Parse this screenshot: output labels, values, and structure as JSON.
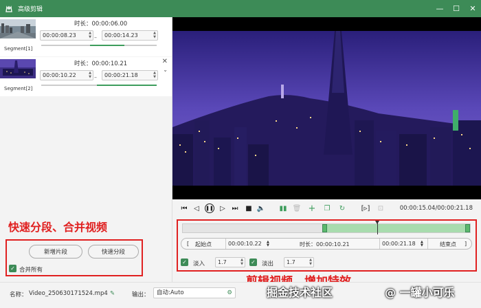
{
  "window": {
    "title": "高级剪辑",
    "min": "—",
    "max": "☐",
    "close": "✕"
  },
  "segments": [
    {
      "label": "Segment[1]",
      "duration": "时长：00:00:06.00",
      "start": "00:00:08.23",
      "end": "00:00:14.23",
      "fill_start": 0.42,
      "fill_end": 0.72
    },
    {
      "label": "Segment[2]",
      "duration": "时长：00:00:10.21",
      "start": "00:00:10.22",
      "end": "00:00:21.18",
      "fill_start": 0.48,
      "fill_end": 1.0
    }
  ],
  "left_panel": {
    "annotation": "快速分段、合并视频",
    "add_segment": "新增片段",
    "quick_split": "快速分段",
    "merge_all": "合并所有"
  },
  "player": {
    "timecode": "00:00:15.04/00:00:21.18",
    "track": {
      "sel_start": 0.485,
      "sel_end": 1.0,
      "playhead": 0.68
    },
    "start_label": "起始点",
    "start_time": "00:00:10.22",
    "duration": "时长：00:00:10.21",
    "end_time": "00:00:21.18",
    "end_label": "结束点",
    "fade_in": "淡入",
    "fade_in_value": "1.7",
    "fade_out": "淡出",
    "fade_out_value": "1.7"
  },
  "edit_annotation": "剪辑视频，增加特效",
  "bottom": {
    "name_label": "名称：",
    "filename": "Video_250630171524.mp4",
    "output_label": "输出：",
    "output_value": "自动:Auto"
  },
  "watermark": {
    "left": "掘金技术社区",
    "right": "@ 一罐小可乐"
  },
  "colors": {
    "accent": "#3d8b57",
    "annotation": "#e02020"
  }
}
